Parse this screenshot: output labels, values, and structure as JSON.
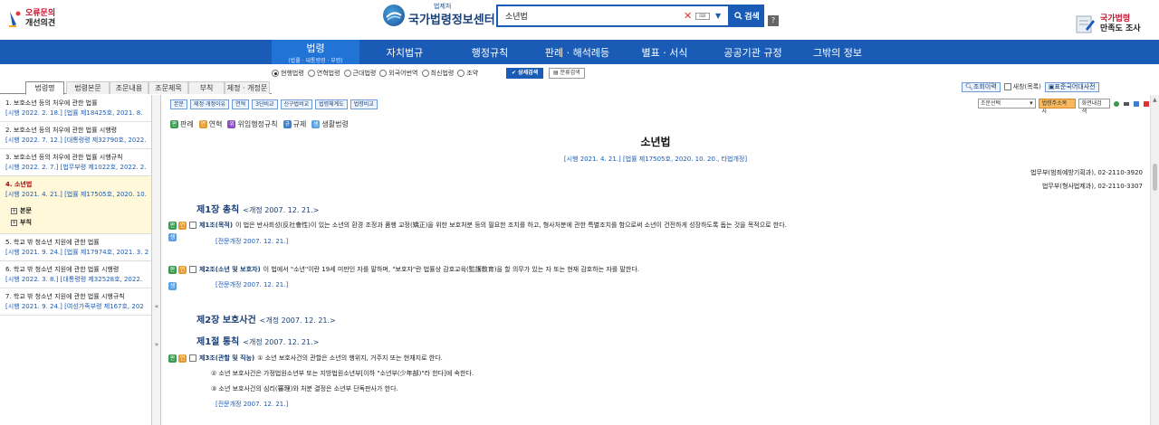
{
  "header": {
    "left_line1": "오류문의",
    "left_line2": "개선의견",
    "logo_small": "법제처",
    "logo_title": "국가법령정보센터",
    "search_value": "소년법",
    "search_button": "검색",
    "help": "?",
    "right_line1": "국가법령",
    "right_line2": "만족도 조사"
  },
  "menu": [
    {
      "label": "법령",
      "sub": "(법률 · 대통령령 · 부령)"
    },
    {
      "label": "자치법규"
    },
    {
      "label": "행정규칙"
    },
    {
      "label": "판례 · 해석례등"
    },
    {
      "label": "별표 · 서식"
    },
    {
      "label": "공공기관 규정"
    },
    {
      "label": "그밖의 정보"
    }
  ],
  "options": {
    "radios": [
      "현행법령",
      "연혁법령",
      "근대법령",
      "외국어번역",
      "최신법령",
      "조약"
    ],
    "detail_search": "상세검색",
    "category_search": "분류검색"
  },
  "left_tabs": [
    "법령명",
    "법령본문",
    "조문내용",
    "조문제목",
    "부칙",
    "제정 · 개정문"
  ],
  "right_tools": {
    "view_history": "조회이력",
    "new_window": "새창(목록)",
    "dictionary": "표준국어대사전"
  },
  "left_list": [
    {
      "name": "1. 보호소년 등의 처우에 관한 법률",
      "meta": "[시행 2022. 2. 18.] [법률 제18425호, 2021. 8."
    },
    {
      "name": "2. 보호소년 등의 처우에 관한 법률 시행령",
      "meta": "[시행 2022. 7. 12.] [대통령령 제32790호, 2022."
    },
    {
      "name": "3. 보호소년 등의 처우에 관한 법률 시행규칙",
      "meta": "[시행 2022. 2. 7.] [법무부령 제1022호, 2022. 2."
    },
    {
      "name": "4. 소년법",
      "meta": "[시행 2021. 4. 21.] [법률 제17505호, 2020. 10."
    },
    {
      "name": "5. 학교 밖 청소년 지원에 관한 법률",
      "meta": "[시행 2021. 9. 24.] [법률 제17974호, 2021. 3. 2"
    },
    {
      "name": "6. 학교 밖 청소년 지원에 관한 법률 시행령",
      "meta": "[시행 2022. 3. 8.] [대통령령 제32528호, 2022."
    },
    {
      "name": "7. 학교 밖 청소년 지원에 관한 법률 시행규칙",
      "meta": "[시행 2021. 9. 24.] [여성가족부령 제167호, 202"
    }
  ],
  "subtree": [
    "본문",
    "부칙"
  ],
  "content_tools": [
    "본문",
    "제정·개정이유",
    "연혁",
    "3단비교",
    "신구법비교",
    "법령체계도",
    "법령비교"
  ],
  "content_right": {
    "select": "조문선택",
    "law_name_btn": "법령주소복사",
    "print_btn": "화면내검색"
  },
  "legend": [
    {
      "badge": "판",
      "label": "판례"
    },
    {
      "badge": "연",
      "label": "연혁"
    },
    {
      "badge": "위",
      "label": "위임행정규칙"
    },
    {
      "badge": "규",
      "label": "규제"
    },
    {
      "badge": "생",
      "label": "생활법령"
    }
  ],
  "law": {
    "title": "소년법",
    "enforce": "[시행 2021. 4. 21.] [법률 제17505호, 2020. 10. 20., 타법개정]",
    "dept1": "법무부(범죄예방기획과), 02-2110-3920",
    "dept2": "법무부(형사법제과), 02-2110-3307",
    "ch1": "제1장 총칙",
    "ch1_rev": "<개정 2007. 12. 21.>",
    "a1_title": "제1조(목적)",
    "a1_text": "이 법은 반사회성(反社會性)이 있는 소년의 환경 조정과 품행 교정(矯正)을 위한 보호처분 등의 필요한 조치를 하고, 형사처분에 관한 특별조치를 함으로써 소년이 건전하게 성장하도록 돕는 것을 목적으로 한다.",
    "a1_rev": "[전문개정 2007. 12. 21.]",
    "a2_title": "제2조(소년 및 보호자)",
    "a2_text": "이 법에서 \"소년\"이란 19세 미만인 자를 말하며, \"보호자\"란 법률상 감호교육(監護敎育)을 할 의무가 있는 자 또는 현재 감호하는 자를 말한다.",
    "a2_rev": "[전문개정 2007. 12. 21.]",
    "ch2": "제2장 보호사건",
    "ch2_rev": "<개정 2007. 12. 21.>",
    "sec1": "제1절 통칙",
    "sec1_rev": "<개정 2007. 12. 21.>",
    "a3_title": "제3조(관할 및 직능)",
    "a3_p1": "① 소년 보호사건의 관할은 소년의 행위지, 거주지 또는 현재지로 한다.",
    "a3_p2": "② 소년 보호사건은 가정법원소년부 또는 지방법원소년부[이하 \"소년부(少年部)\"라 한다]에 속한다.",
    "a3_p3": "③ 소년 보호사건의 심리(審理)와 처분 결정은 소년부 단독판사가 한다.",
    "a3_rev": "[전문개정 2007. 12. 21.]"
  },
  "colors": {
    "primary": "#1a5bb5",
    "menu_active": "#2273d6",
    "chapter": "#1a3f73",
    "active_item": "#b30000"
  }
}
